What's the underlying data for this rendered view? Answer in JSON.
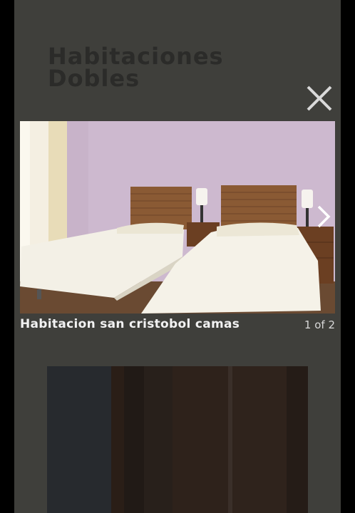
{
  "header": {
    "title_line1": "Habitaciones",
    "title_line2": "Dobles"
  },
  "lightbox": {
    "caption": "Habitacion san cristobol camas",
    "counter": "1 of 2",
    "close_icon": "close-icon",
    "next_icon": "chevron-right-icon"
  },
  "colors": {
    "backdrop": "#000000",
    "panel": "#3f3f3b",
    "title": "#2b2b29",
    "caption": "#f2f2f2"
  }
}
